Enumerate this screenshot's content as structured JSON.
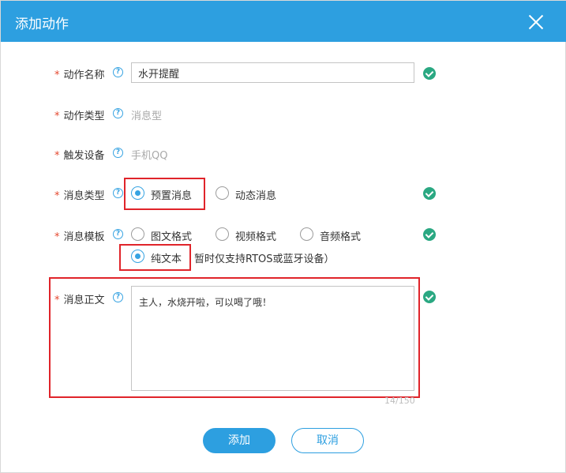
{
  "dialog": {
    "title": "添加动作",
    "close_icon": "close-icon"
  },
  "form": {
    "required_mark": "*",
    "help_glyph": "?",
    "action_name": {
      "label": "动作名称",
      "value": "水开提醒"
    },
    "action_type": {
      "label": "动作类型",
      "value": "消息型"
    },
    "trigger_device": {
      "label": "触发设备",
      "value": "手机QQ"
    },
    "message_type": {
      "label": "消息类型",
      "options": [
        "预置消息",
        "动态消息"
      ],
      "selected": "预置消息"
    },
    "message_template": {
      "label": "消息模板",
      "options": [
        "图文格式",
        "视频格式",
        "音频格式",
        "纯文本"
      ],
      "selected": "纯文本",
      "note": "暂时仅支持RTOS或蓝牙设备）"
    },
    "message_body": {
      "label": "消息正文",
      "value": "主人，水烧开啦，可以喝了哦！",
      "counter": "14/150"
    }
  },
  "buttons": {
    "submit": "添加",
    "cancel": "取消"
  },
  "colors": {
    "header": "#2d9fe0",
    "accent": "#37a3e2",
    "success": "#2aa882",
    "required": "#e5482f",
    "highlight_box": "#e0242a"
  }
}
